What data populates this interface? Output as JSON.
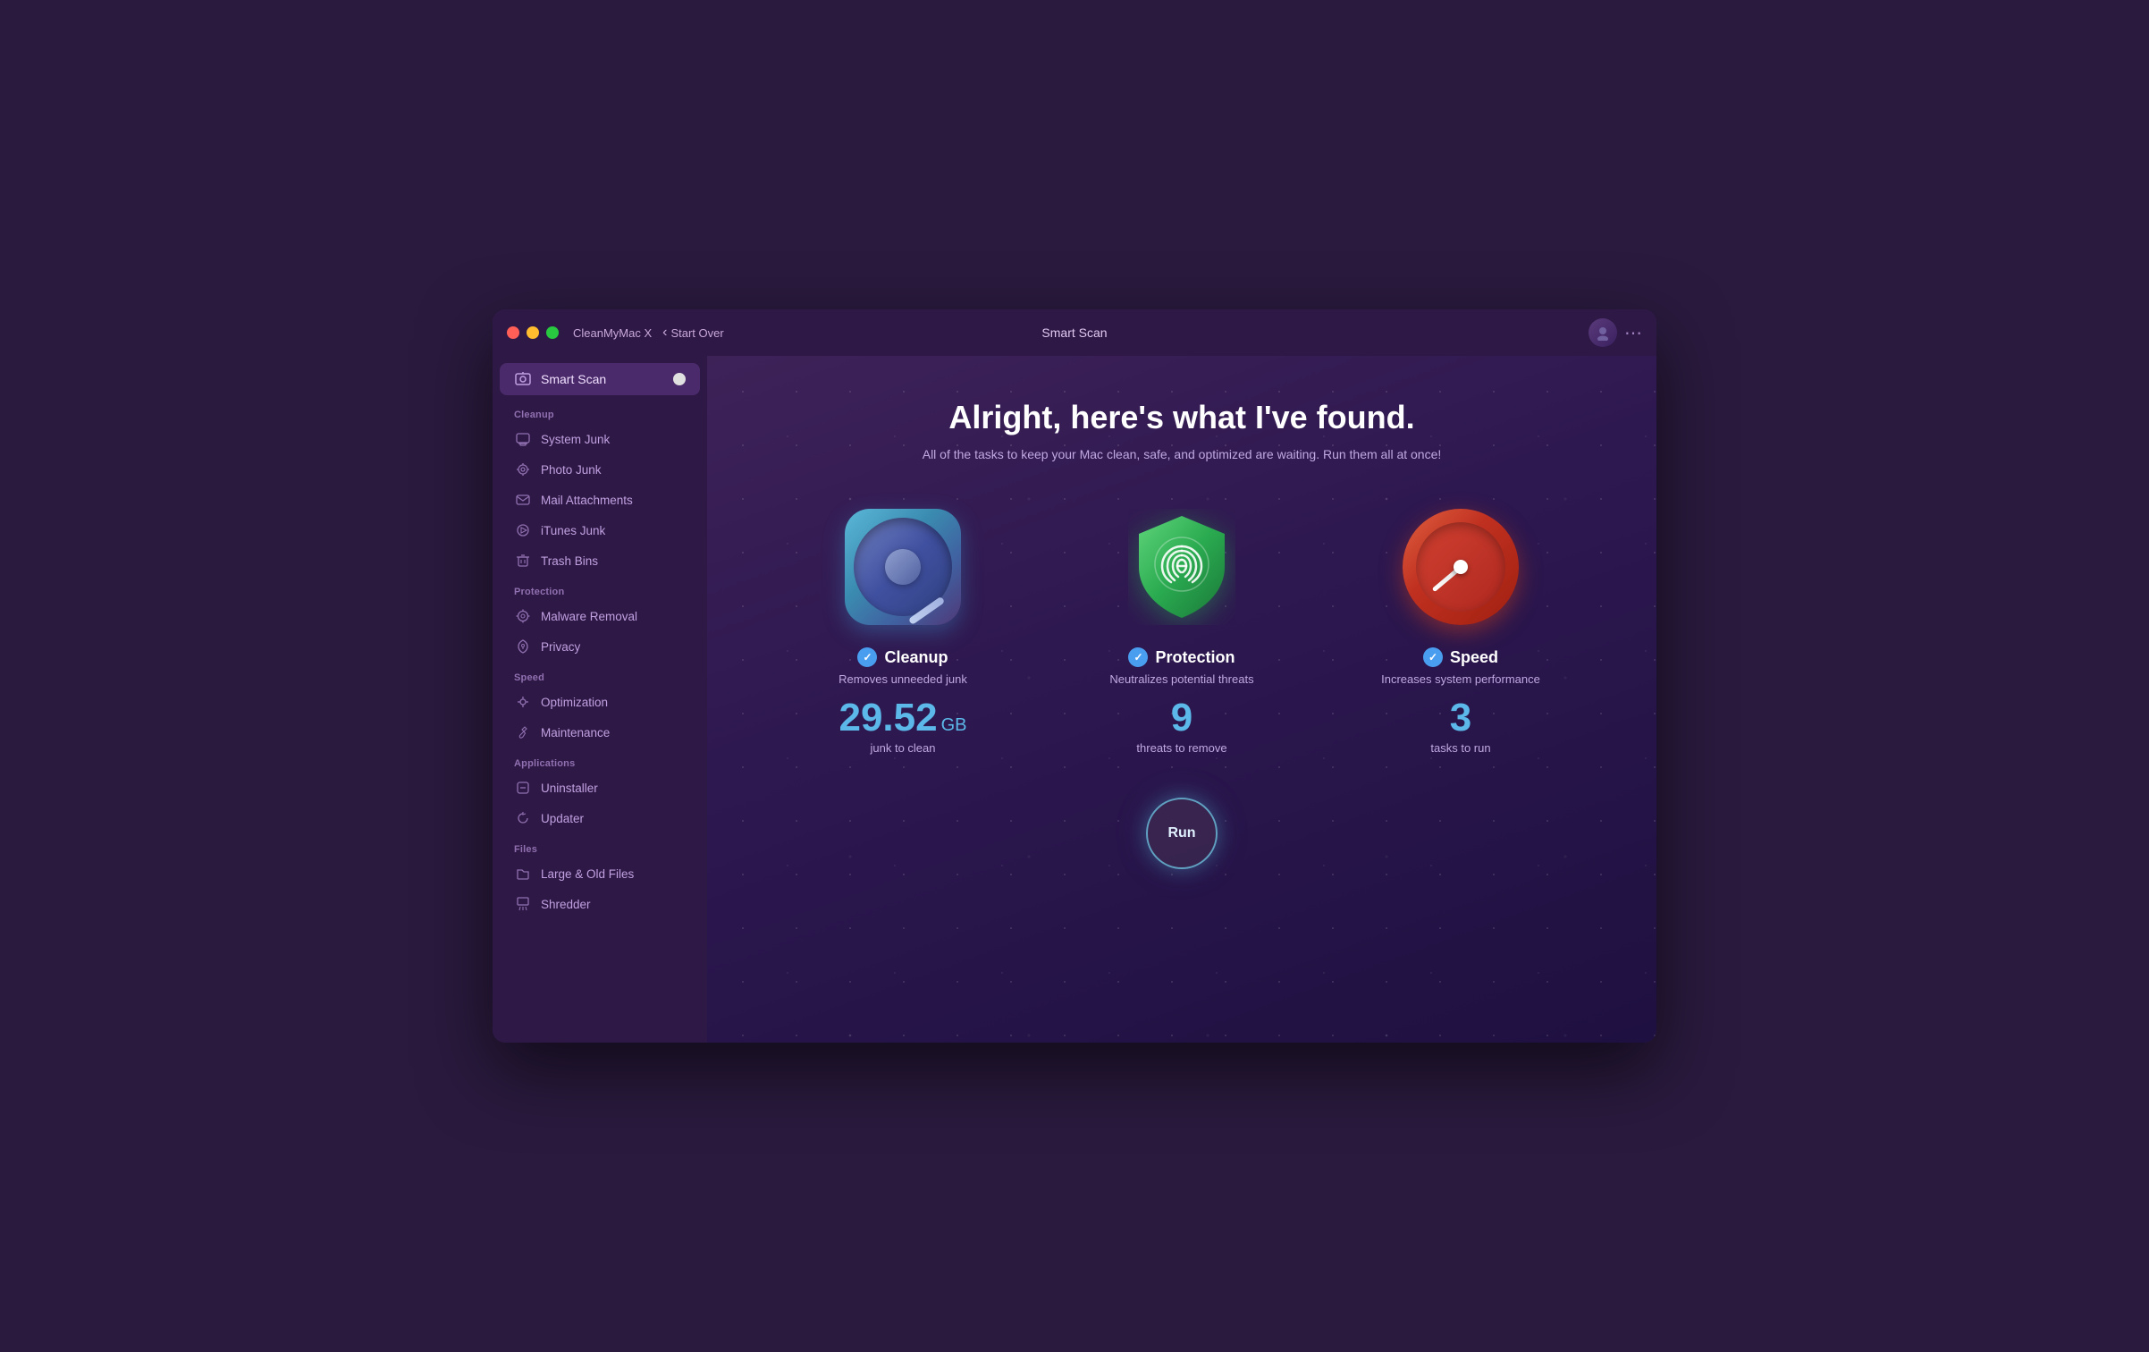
{
  "window": {
    "app_title": "CleanMyMac X",
    "nav_back": "Start Over",
    "window_title": "Smart Scan"
  },
  "sidebar": {
    "smart_scan_label": "Smart Scan",
    "cleanup_header": "Cleanup",
    "cleanup_items": [
      {
        "label": "System Junk",
        "icon": "🖥"
      },
      {
        "label": "Photo Junk",
        "icon": "❄"
      },
      {
        "label": "Mail Attachments",
        "icon": "✉"
      },
      {
        "label": "iTunes Junk",
        "icon": "♪"
      },
      {
        "label": "Trash Bins",
        "icon": "🗑"
      }
    ],
    "protection_header": "Protection",
    "protection_items": [
      {
        "label": "Malware Removal",
        "icon": "☢"
      },
      {
        "label": "Privacy",
        "icon": "✋"
      }
    ],
    "speed_header": "Speed",
    "speed_items": [
      {
        "label": "Optimization",
        "icon": "⚙"
      },
      {
        "label": "Maintenance",
        "icon": "🔧"
      }
    ],
    "applications_header": "Applications",
    "applications_items": [
      {
        "label": "Uninstaller",
        "icon": "📦"
      },
      {
        "label": "Updater",
        "icon": "🔄"
      }
    ],
    "files_header": "Files",
    "files_items": [
      {
        "label": "Large & Old Files",
        "icon": "📁"
      },
      {
        "label": "Shredder",
        "icon": "📋"
      }
    ]
  },
  "content": {
    "heading": "Alright, here's what I've found.",
    "subheading": "All of the tasks to keep your Mac clean, safe, and optimized are waiting. Run them all at once!",
    "cleanup": {
      "title": "Cleanup",
      "desc": "Removes unneeded junk",
      "value": "29.52",
      "unit": "GB",
      "label": "junk to clean"
    },
    "protection": {
      "title": "Protection",
      "desc": "Neutralizes potential threats",
      "value": "9",
      "label": "threats to remove"
    },
    "speed": {
      "title": "Speed",
      "desc": "Increases system performance",
      "value": "3",
      "label": "tasks to run"
    },
    "run_button": "Run"
  }
}
